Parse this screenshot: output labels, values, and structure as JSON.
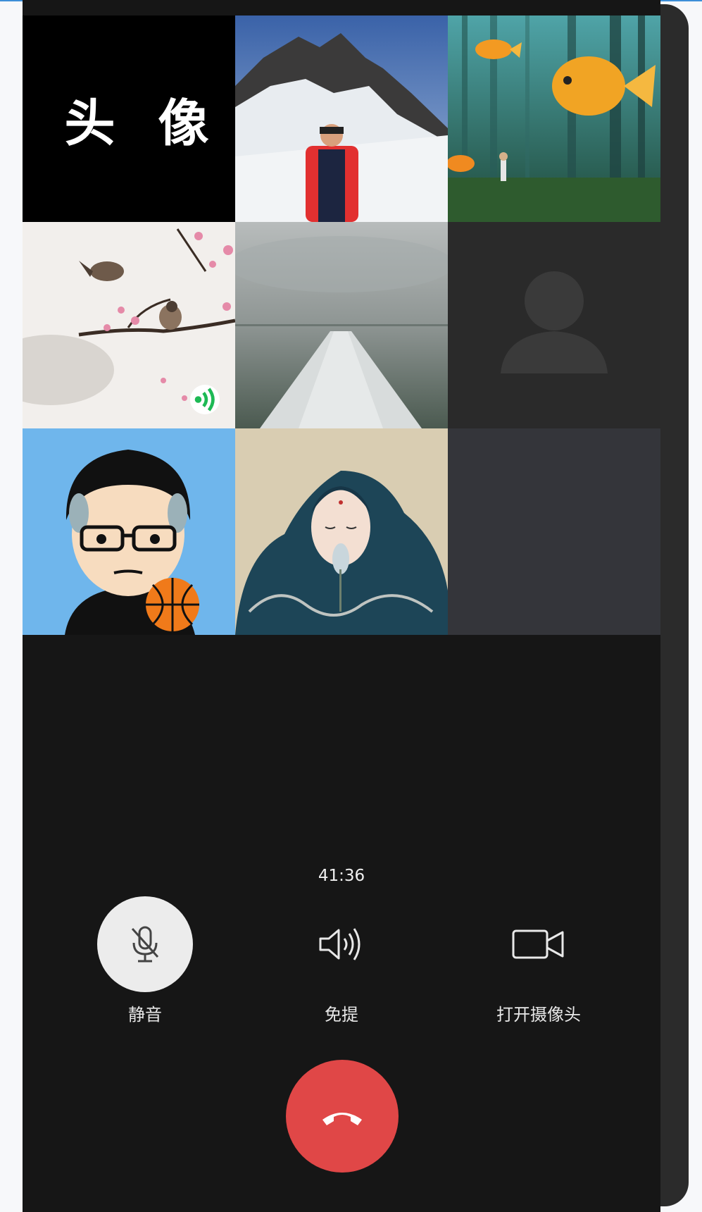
{
  "call": {
    "duration": "41:36"
  },
  "participants": [
    {
      "id": "p1",
      "avatar_text": "头 像"
    },
    {
      "id": "p2",
      "avatar_desc": "mountain-snow-photo"
    },
    {
      "id": "p3",
      "avatar_desc": "goldfish-forest-art"
    },
    {
      "id": "p4",
      "avatar_desc": "bird-blossom-painting",
      "speaking": true
    },
    {
      "id": "p5",
      "avatar_desc": "pier-lake-photo"
    },
    {
      "id": "p6",
      "avatar_desc": "default-person-silhouette"
    },
    {
      "id": "p7",
      "avatar_desc": "cartoon-boy-basketball"
    },
    {
      "id": "p8",
      "avatar_desc": "woman-blue-hair-art"
    },
    {
      "id": "p9",
      "avatar_desc": "empty-slot"
    }
  ],
  "controls": {
    "mute": {
      "label": "静音",
      "icon": "mic-off-icon",
      "active": true
    },
    "speaker": {
      "label": "免提",
      "icon": "speaker-icon",
      "active": false
    },
    "camera": {
      "label": "打开摄像头",
      "icon": "video-camera-icon",
      "active": false
    },
    "hangup": {
      "icon": "phone-hangup-icon"
    }
  },
  "colors": {
    "background": "#161616",
    "hangup": "#e04747",
    "active_button": "#ececec",
    "text": "#e8e8e8"
  }
}
